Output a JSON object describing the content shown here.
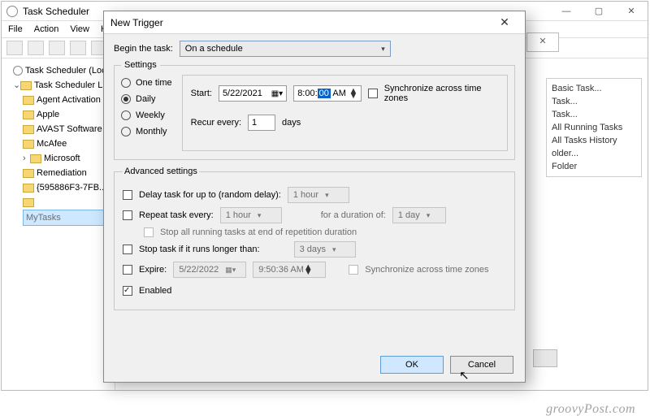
{
  "main": {
    "title": "Task Scheduler",
    "menubar": [
      "File",
      "Action",
      "View",
      "Help"
    ],
    "tree": {
      "root": "Task Scheduler (Local)",
      "lib": "Task Scheduler Library",
      "items": [
        "Agent Activation",
        "Apple",
        "AVAST Software",
        "McAfee",
        "Microsoft",
        "Remediation",
        "{595886F3-7FB...}",
        "MyTasks"
      ],
      "selected": "MyTasks"
    }
  },
  "actions": {
    "items": [
      "Basic Task...",
      "Task...",
      "Task...",
      "All Running Tasks",
      "All Tasks History",
      "older...",
      "Folder"
    ]
  },
  "dialog": {
    "title": "New Trigger",
    "begin_label": "Begin the task:",
    "begin_value": "On a schedule",
    "settings_legend": "Settings",
    "radios": {
      "one": "One time",
      "daily": "Daily",
      "weekly": "Weekly",
      "monthly": "Monthly"
    },
    "start_label": "Start:",
    "start_date": "5/22/2021",
    "start_time_pre": "8:00:",
    "start_time_sel": "00",
    "start_time_post": " AM",
    "sync_tz": "Synchronize across time zones",
    "recur_label": "Recur every:",
    "recur_value": "1",
    "recur_unit": "days",
    "advanced_legend": "Advanced settings",
    "delay_label": "Delay task for up to (random delay):",
    "delay_value": "1 hour",
    "repeat_label": "Repeat task every:",
    "repeat_value": "1 hour",
    "duration_label": "for a duration of:",
    "duration_value": "1 day",
    "stop_rep": "Stop all running tasks at end of repetition duration",
    "stop_long_label": "Stop task if it runs longer than:",
    "stop_long_value": "3 days",
    "expire_label": "Expire:",
    "expire_date": "5/22/2022",
    "expire_time": "9:50:36 AM",
    "expire_sync": "Synchronize across time zones",
    "enabled_label": "Enabled",
    "ok": "OK",
    "cancel": "Cancel"
  },
  "watermark": "groovyPost.com"
}
